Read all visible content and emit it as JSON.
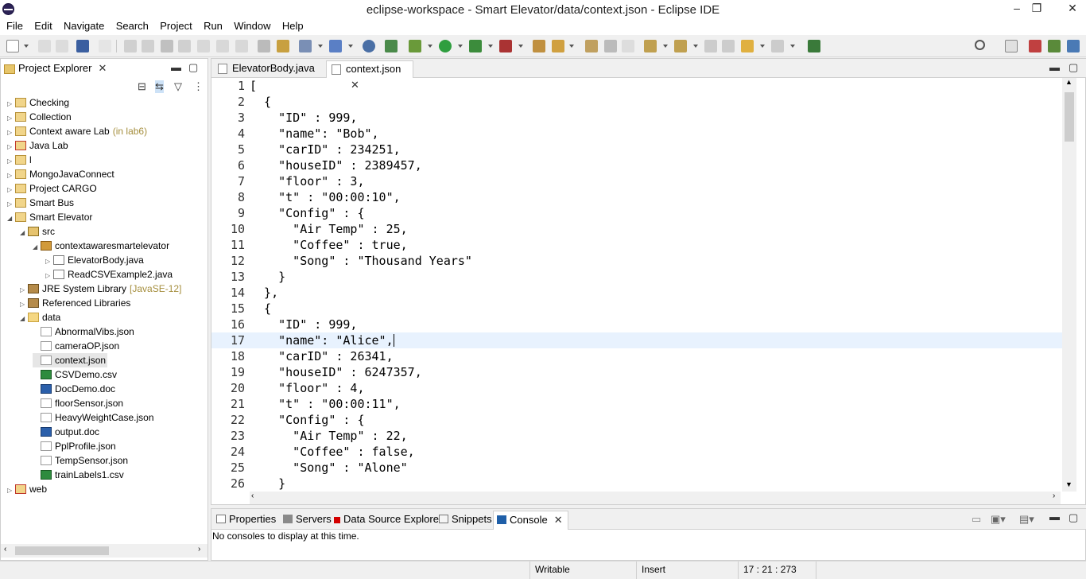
{
  "window": {
    "title": "eclipse-workspace - Smart Elevator/data/context.json - Eclipse IDE",
    "minimize": "–",
    "maximize": "❐",
    "close": "✕"
  },
  "menu": [
    "File",
    "Edit",
    "Navigate",
    "Search",
    "Project",
    "Run",
    "Window",
    "Help"
  ],
  "project_explorer": {
    "title": "Project Explorer",
    "items": [
      {
        "label": "Checking",
        "qualifier": "",
        "icon": "project",
        "arrow": "▷"
      },
      {
        "label": "Collection",
        "qualifier": "",
        "icon": "project",
        "arrow": "▷"
      },
      {
        "label": "Context aware Lab",
        "qualifier": "(in lab6)",
        "icon": "project",
        "arrow": "▷"
      },
      {
        "label": "Java Lab",
        "qualifier": "",
        "icon": "project-error",
        "arrow": "▷"
      },
      {
        "label": "l",
        "qualifier": "",
        "icon": "project",
        "arrow": "▷"
      },
      {
        "label": "MongoJavaConnect",
        "qualifier": "",
        "icon": "project",
        "arrow": "▷"
      },
      {
        "label": "Project CARGO",
        "qualifier": "",
        "icon": "project",
        "arrow": "▷"
      },
      {
        "label": "Smart Bus",
        "qualifier": "",
        "icon": "project",
        "arrow": "▷"
      },
      {
        "label": "Smart Elevator",
        "qualifier": "",
        "icon": "project",
        "arrow": "◢"
      },
      {
        "label": "src",
        "qualifier": "",
        "icon": "src",
        "arrow": "◢"
      },
      {
        "label": "contextawaresmartelevator",
        "qualifier": "",
        "icon": "package",
        "arrow": "◢"
      },
      {
        "label": "ElevatorBody.java",
        "qualifier": "",
        "icon": "java",
        "arrow": "▷"
      },
      {
        "label": "ReadCSVExample2.java",
        "qualifier": "",
        "icon": "java",
        "arrow": "▷"
      },
      {
        "label": "JRE System Library",
        "qualifier": "[JavaSE-12]",
        "icon": "library",
        "arrow": "▷"
      },
      {
        "label": "Referenced Libraries",
        "qualifier": "",
        "icon": "library",
        "arrow": "▷"
      },
      {
        "label": "data",
        "qualifier": "",
        "icon": "folder",
        "arrow": "◢"
      },
      {
        "label": "AbnormalVibs.json",
        "qualifier": "",
        "icon": "file",
        "arrow": ""
      },
      {
        "label": "cameraOP.json",
        "qualifier": "",
        "icon": "file",
        "arrow": ""
      },
      {
        "label": "context.json",
        "qualifier": "",
        "icon": "file",
        "arrow": ""
      },
      {
        "label": "CSVDemo.csv",
        "qualifier": "",
        "icon": "csv",
        "arrow": ""
      },
      {
        "label": "DocDemo.doc",
        "qualifier": "",
        "icon": "doc",
        "arrow": ""
      },
      {
        "label": "floorSensor.json",
        "qualifier": "",
        "icon": "file",
        "arrow": ""
      },
      {
        "label": "HeavyWeightCase.json",
        "qualifier": "",
        "icon": "file",
        "arrow": ""
      },
      {
        "label": "output.doc",
        "qualifier": "",
        "icon": "doc",
        "arrow": ""
      },
      {
        "label": "PplProfile.json",
        "qualifier": "",
        "icon": "file",
        "arrow": ""
      },
      {
        "label": "TempSensor.json",
        "qualifier": "",
        "icon": "file",
        "arrow": ""
      },
      {
        "label": "trainLabels1.csv",
        "qualifier": "",
        "icon": "csv",
        "arrow": ""
      },
      {
        "label": "web",
        "qualifier": "",
        "icon": "project-error",
        "arrow": "▷"
      }
    ]
  },
  "editor": {
    "tabs": [
      {
        "label": "ElevatorBody.java",
        "active": false
      },
      {
        "label": "context.json",
        "active": true
      }
    ],
    "current_line": 17,
    "lines": [
      "[",
      "  {",
      "    \"ID\" : 999,",
      "    \"name\": \"Bob\",",
      "    \"carID\" : 234251,",
      "    \"houseID\" : 2389457,",
      "    \"floor\" : 3,",
      "    \"t\" : \"00:00:10\",",
      "    \"Config\" : {",
      "      \"Air Temp\" : 25,",
      "      \"Coffee\" : true,",
      "      \"Song\" : \"Thousand Years\"",
      "    }",
      "  },",
      "  {",
      "    \"ID\" : 999,",
      "    \"name\": \"Alice\",",
      "    \"carID\" : 26341,",
      "    \"houseID\" : 6247357,",
      "    \"floor\" : 4,",
      "    \"t\" : \"00:00:11\",",
      "    \"Config\" : {",
      "      \"Air Temp\" : 22,",
      "      \"Coffee\" : false,",
      "      \"Song\" : \"Alone\"",
      "    }"
    ]
  },
  "bottom_panel": {
    "tabs": [
      {
        "label": "Properties",
        "active": false
      },
      {
        "label": "Servers",
        "active": false
      },
      {
        "label": "Data Source Explorer",
        "active": false
      },
      {
        "label": "Snippets",
        "active": false
      },
      {
        "label": "Console",
        "active": true
      }
    ],
    "message": "No consoles to display at this time."
  },
  "status": {
    "mode": "Writable",
    "insert": "Insert",
    "position": "17 : 21 : 273"
  },
  "colors": {
    "current_line": "#e8f2fe",
    "qualifier": "#a58e3d",
    "console_icon": "#1f5fa8",
    "data_source_icon": "#d40000"
  }
}
